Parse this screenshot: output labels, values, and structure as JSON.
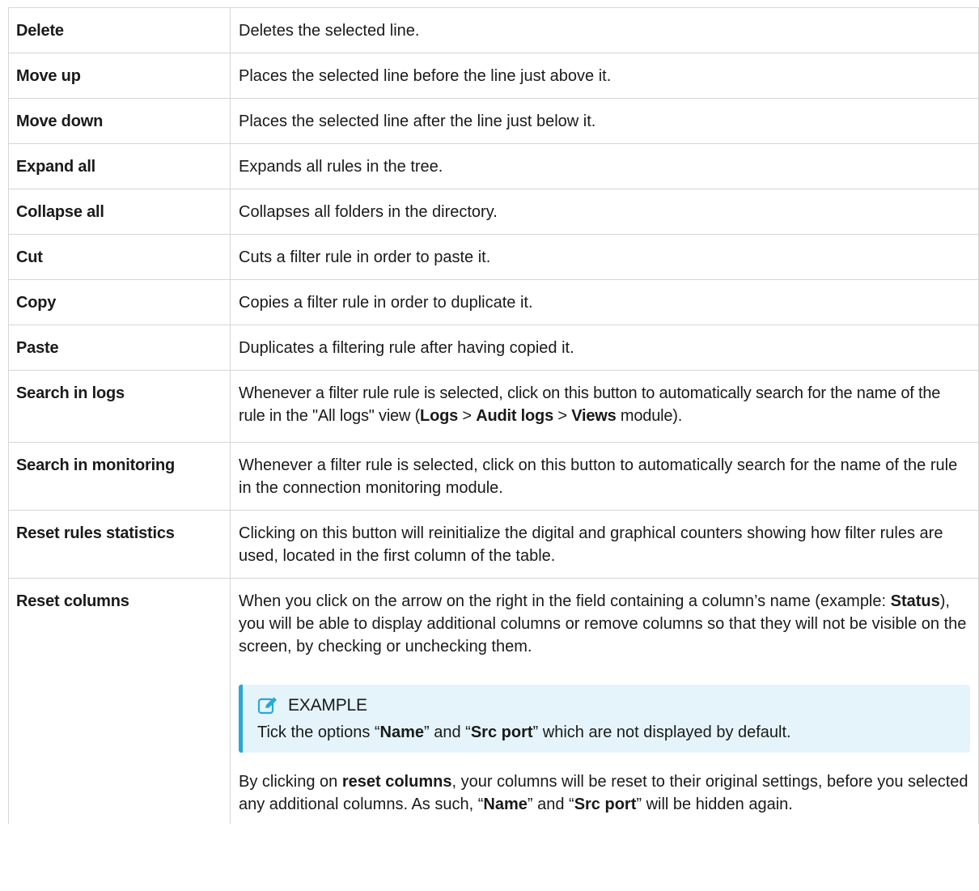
{
  "rows": [
    {
      "term": "Delete",
      "desc": "Deletes the selected line."
    },
    {
      "term": "Move up",
      "desc": "Places the selected line before the line just above it."
    },
    {
      "term": "Move down",
      "desc": "Places the selected line after the line just below it."
    },
    {
      "term": "Expand all",
      "desc": "Expands all rules in the tree."
    },
    {
      "term": "Collapse all",
      "desc": "Collapses all folders in the directory."
    },
    {
      "term": "Cut",
      "desc": "Cuts a filter rule in order to paste it."
    },
    {
      "term": "Copy",
      "desc": "Copies a filter rule in order to duplicate it."
    },
    {
      "term": "Paste",
      "desc": "Duplicates a filtering rule after having copied it."
    }
  ],
  "search_logs": {
    "term": "Search in logs",
    "text1": "Whenever a filter rule rule is selected, click on this button to automatically search for the name of the rule in the \"All logs\" view (",
    "b1": "Logs",
    "sep1": " > ",
    "b2": "Audit logs",
    "sep2": " > ",
    "b3": "Views",
    "text2": " module)."
  },
  "search_monitoring": {
    "term": "Search in monitoring",
    "desc": "Whenever a filter rule is selected, click on this button to automatically search for the name of the rule in the connection monitoring module."
  },
  "reset_stats": {
    "term": "Reset rules statistics",
    "desc": "Clicking on this button will reinitialize the digital and graphical counters showing how filter rules are used, located in the first column of the table."
  },
  "reset_columns": {
    "term": "Reset columns",
    "p1_a": "When you click on the arrow on the right in the field containing a column’s name (example: ",
    "p1_b": "Status",
    "p1_c": "), you will be able to display additional columns or remove columns so that they will not be visible on the screen, by checking or unchecking them.",
    "note_icon": "edit-icon",
    "note_title": "EXAMPLE",
    "note_a": "Tick the options “",
    "note_b": "Name",
    "note_c": "” and “",
    "note_d": "Src port",
    "note_e": "” which are not displayed by default.",
    "p2_a": "By clicking on ",
    "p2_b": "reset columns",
    "p2_c": ", your columns will be reset to their original settings, before you selected any additional columns. As such, “",
    "p2_d": "Name",
    "p2_e": "” and “",
    "p2_f": "Src port",
    "p2_g": "” will be hidden again."
  },
  "colors": {
    "border": "#d6d6d6",
    "note_bg": "#e5f4fb",
    "note_accent": "#29a8d8"
  }
}
